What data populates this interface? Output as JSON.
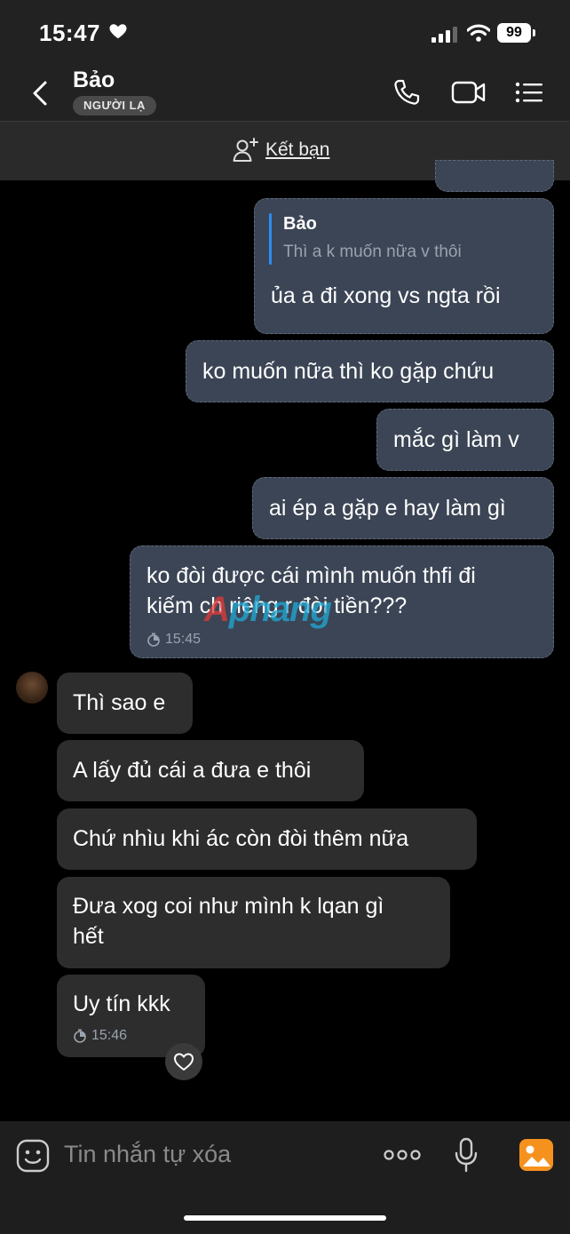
{
  "status_bar": {
    "time": "15:47",
    "battery": "99"
  },
  "header": {
    "contact_name": "Bảo",
    "badge": "NGƯỜI LẠ"
  },
  "add_friend": {
    "label": "Kết bạn"
  },
  "messages": {
    "quoted": {
      "name": "Bảo",
      "text": "Thì a k muốn nữa v thôi",
      "reply": "ủa a đi xong vs ngta rồi"
    },
    "out_2": "ko muốn nữa thì ko gặp chứu",
    "out_3": "mắc gì làm v",
    "out_4": "ai ép a gặp e hay làm gì",
    "out_5": "ko đòi được cái mình muốn thfi đi\nkiếm ch riêng r đòi tiền???",
    "out_5_time": "15:45",
    "in_1": "Thì sao e",
    "in_2": "A lấy đủ cái a đưa e thôi",
    "in_3": "Chứ nhìu khi ác còn đòi thêm nữa",
    "in_4": "Đưa xog coi như mình k lqan gì\nhết",
    "in_5": "Uy tín kkk",
    "in_5_time": "15:46"
  },
  "watermark": {
    "a": "A",
    "rest": "phang"
  },
  "composer": {
    "placeholder": "Tin nhắn tự xóa"
  },
  "colors": {
    "outgoing_bubble": "#3b4555",
    "incoming_bubble": "#2d2d2d",
    "quote_bar": "#2d8cf0",
    "accent_orange": "#f5921e"
  }
}
